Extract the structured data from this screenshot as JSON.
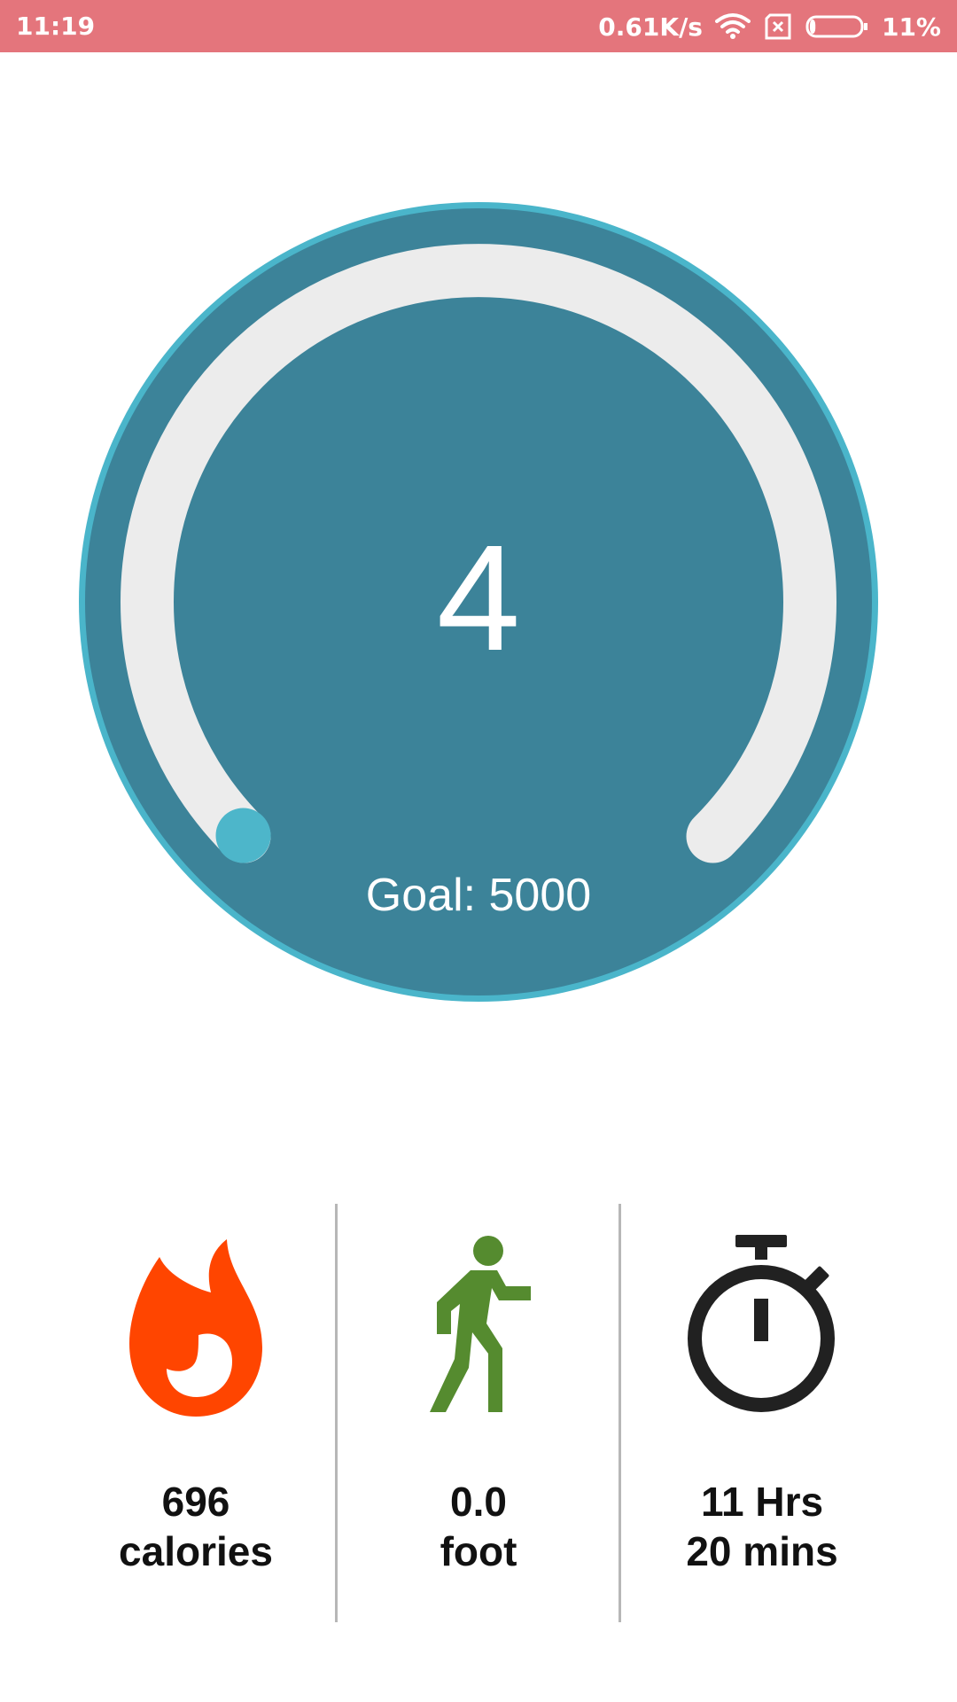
{
  "status_bar": {
    "time": "11:19",
    "network_speed": "0.61K/s",
    "battery_percent": "11%",
    "icons": [
      "wifi-icon",
      "sim-none-icon",
      "battery-icon"
    ],
    "battery_level": 0.11
  },
  "gauge": {
    "steps": "4",
    "goal_label": "Goal: 5000",
    "progress_fraction": 0.0008,
    "colors": {
      "outer_ring": "#4ab5ca",
      "face": "#3c8399",
      "track": "#ececec",
      "progress_knob": "#4db6ca"
    }
  },
  "stats": [
    {
      "icon": "flame-icon",
      "value": "696",
      "unit": "calories",
      "color": "#ff4500"
    },
    {
      "icon": "walking-person-icon",
      "value": "0.0",
      "unit": "foot",
      "color": "#558b2f"
    },
    {
      "icon": "stopwatch-icon",
      "value": "11 Hrs",
      "unit": "20 mins",
      "color": "#212121"
    }
  ]
}
